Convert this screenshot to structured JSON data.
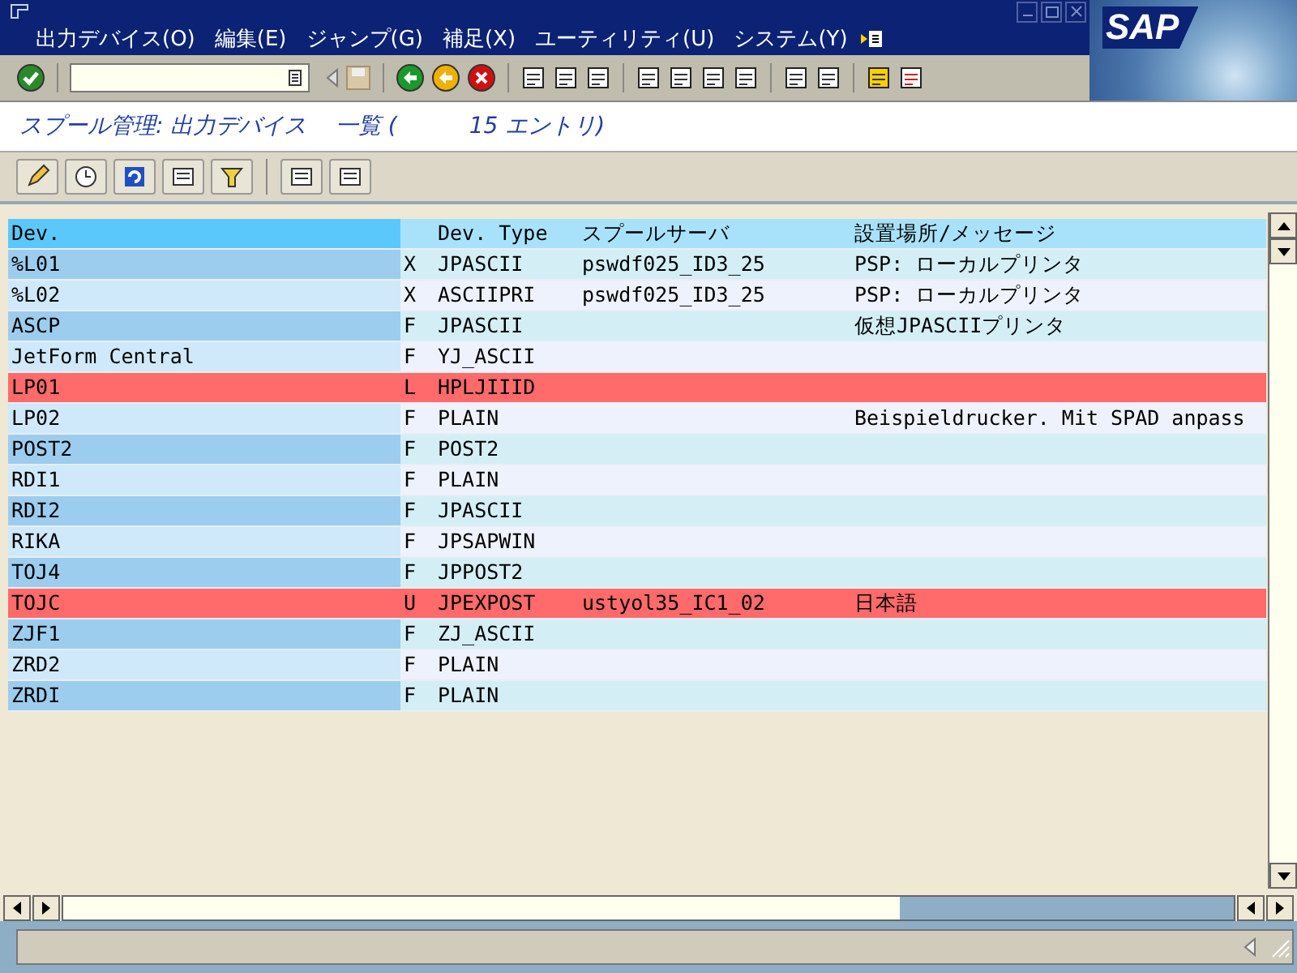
{
  "menu_bar": {
    "items": [
      "出力デバイス(O)",
      "編集(E)",
      "ジャンプ(G)",
      "補足(X)",
      "ユーティリティ(U)",
      "システム(Y)"
    ],
    "logo": "SAP"
  },
  "title": "スプール管理: 出力デバイス    一覧 (          15 エントリ)",
  "table": {
    "columns": [
      "Dev.",
      "",
      "Dev. Type",
      "スプールサーバ",
      "設置場所/メッセージ"
    ],
    "rows": [
      {
        "cells": [
          "%L01",
          "X",
          "JPASCII",
          "pswdf025_ID3_25",
          "PSP: ローカルプリンタ"
        ],
        "highlighted": false
      },
      {
        "cells": [
          "%L02",
          "X",
          "ASCIIPRI",
          "pswdf025_ID3_25",
          "PSP: ローカルプリンタ"
        ],
        "highlighted": false
      },
      {
        "cells": [
          "ASCP",
          "F",
          "JPASCII",
          "",
          "仮想JPASCIIプリンタ"
        ],
        "highlighted": false
      },
      {
        "cells": [
          "JetForm Central",
          "F",
          "YJ_ASCII",
          "",
          ""
        ],
        "highlighted": false
      },
      {
        "cells": [
          "LP01",
          "L",
          "HPLJIIID",
          "",
          ""
        ],
        "highlighted": true
      },
      {
        "cells": [
          "LP02",
          "F",
          "PLAIN",
          "",
          "Beispieldrucker. Mit SPAD anpass"
        ],
        "highlighted": false
      },
      {
        "cells": [
          "POST2",
          "F",
          "POST2",
          "",
          ""
        ],
        "highlighted": false
      },
      {
        "cells": [
          "RDI1",
          "F",
          "PLAIN",
          "",
          ""
        ],
        "highlighted": false
      },
      {
        "cells": [
          "RDI2",
          "F",
          "JPASCII",
          "",
          ""
        ],
        "highlighted": false
      },
      {
        "cells": [
          "RIKA",
          "F",
          "JPSAPWIN",
          "",
          ""
        ],
        "highlighted": false
      },
      {
        "cells": [
          "TOJ4",
          "F",
          "JPPOST2",
          "",
          ""
        ],
        "highlighted": false
      },
      {
        "cells": [
          "TOJC",
          "U",
          "JPEXPOST",
          "ustyol35_IC1_02",
          "日本語"
        ],
        "highlighted": true
      },
      {
        "cells": [
          "ZJF1",
          "F",
          "ZJ_ASCII",
          "",
          ""
        ],
        "highlighted": false
      },
      {
        "cells": [
          "ZRD2",
          "F",
          "PLAIN",
          "",
          ""
        ],
        "highlighted": false
      },
      {
        "cells": [
          "ZRDI",
          "F",
          "PLAIN",
          "",
          ""
        ],
        "highlighted": false
      }
    ]
  }
}
